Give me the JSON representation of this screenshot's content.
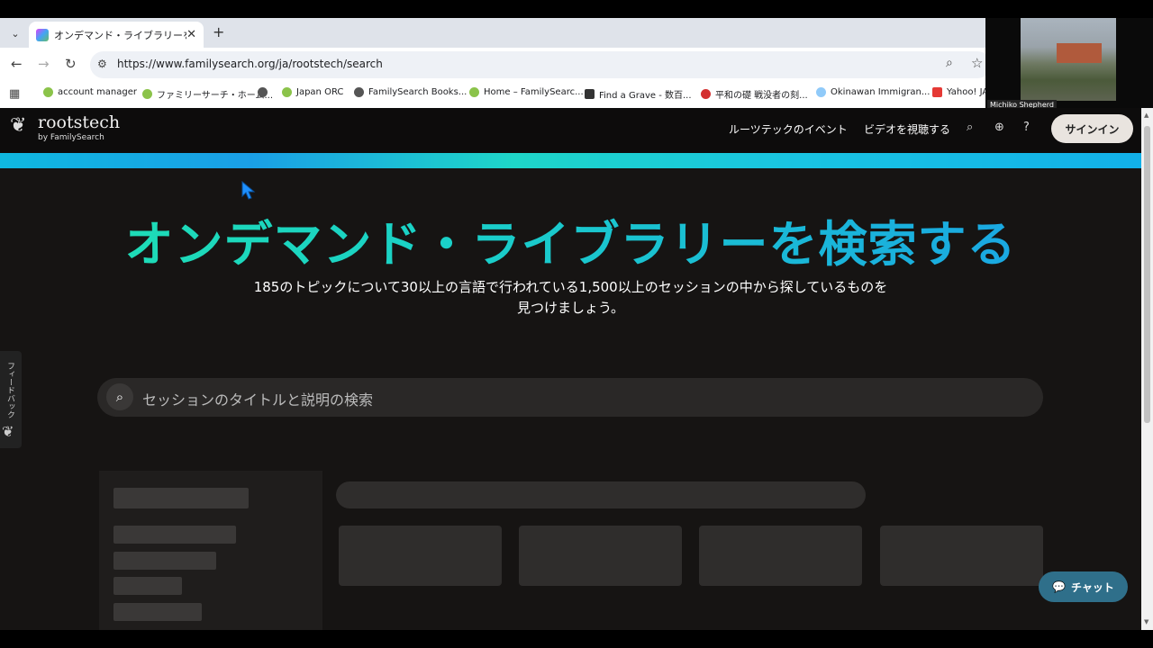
{
  "browser": {
    "tab_title": "オンデマンド・ライブラリーを検索する",
    "tab_close": "✕",
    "new_tab": "+",
    "url": "https://www.familysearch.org/ja/rootstech/search",
    "bookmarks": [
      {
        "label": "account manager"
      },
      {
        "label": "ファミリーサーチ・ホーム..."
      },
      {
        "label": ""
      },
      {
        "label": "Japan ORC"
      },
      {
        "label": "FamilySearch Books..."
      },
      {
        "label": "Home – FamilySearc..."
      },
      {
        "label": "Find a Grave - 数百..."
      },
      {
        "label": "平和の礎 戦没者の刻..."
      },
      {
        "label": "Okinawan Immigran..."
      },
      {
        "label": "Yahoo! JA"
      }
    ]
  },
  "video": {
    "name": "Michiko Shepherd"
  },
  "header": {
    "logo_word": "rootstech",
    "logo_sub": "by FamilySearch",
    "nav": [
      "ルーツテックのイベント",
      "ビデオを視聴する"
    ],
    "signin": "サインイン"
  },
  "hero": {
    "title": "オンデマンド・ライブラリーを検索する",
    "subtitle": "185のトピックについて30以上の言語で行われている1,500以上のセッションの中から探しているものを見つけましょう。"
  },
  "search": {
    "placeholder": "セッションのタイトルと説明の検索"
  },
  "feedback": {
    "label": "フィードバック"
  },
  "chat": {
    "label": "チャット"
  },
  "colors": {
    "accent_teal": "#1fe0b0",
    "accent_blue": "#1a9fe8",
    "chat_bg": "#2f6f8a"
  }
}
